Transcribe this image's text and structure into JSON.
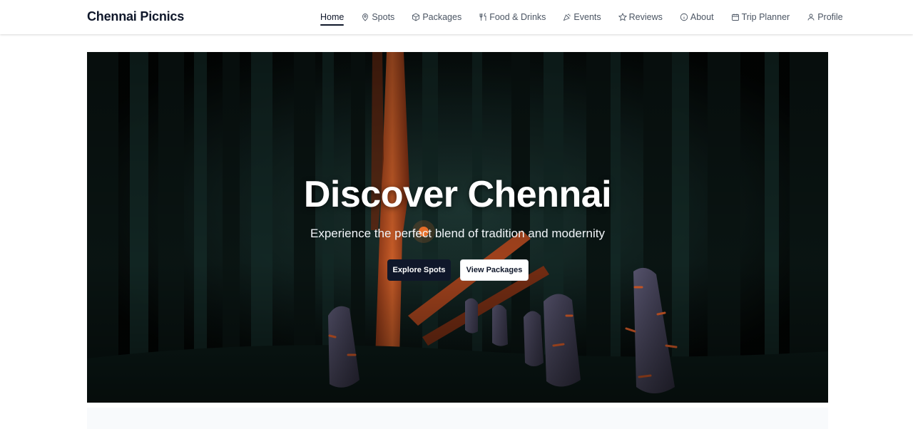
{
  "header": {
    "brand": "Chennai Picnics",
    "nav": [
      {
        "label": "Home",
        "icon": "none",
        "active": true
      },
      {
        "label": "Spots",
        "icon": "map-pin-icon"
      },
      {
        "label": "Packages",
        "icon": "package-icon"
      },
      {
        "label": "Food & Drinks",
        "icon": "utensils-icon"
      },
      {
        "label": "Events",
        "icon": "party-popper-icon"
      },
      {
        "label": "Reviews",
        "icon": "star-icon"
      },
      {
        "label": "About",
        "icon": "info-icon"
      },
      {
        "label": "Trip Planner",
        "icon": "calendar-icon"
      },
      {
        "label": "Profile",
        "icon": "user-icon"
      }
    ]
  },
  "hero": {
    "title": "Discover Chennai",
    "subtitle": "Experience the perfect blend of tradition and modernity",
    "primary_button": "Explore Spots",
    "secondary_button": "View Packages"
  },
  "colors": {
    "brand_dark": "#0f172a",
    "accent_orange": "#e0602a",
    "nav_text": "#4b5563"
  }
}
